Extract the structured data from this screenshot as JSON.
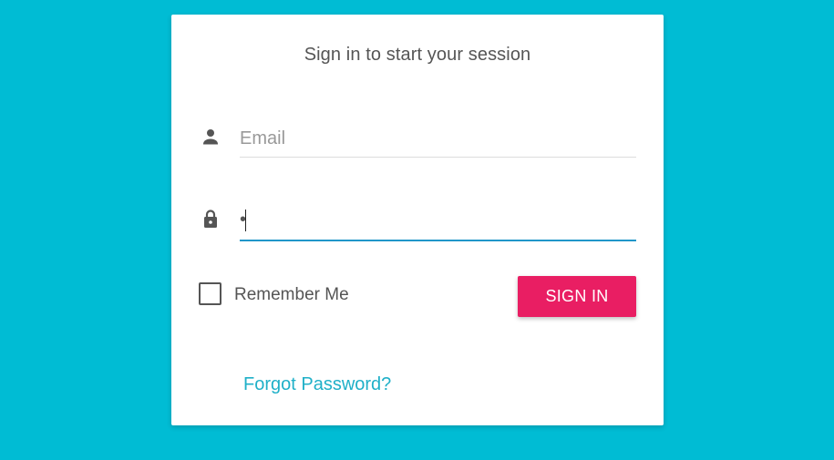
{
  "login": {
    "title": "Sign in to start your session",
    "email": {
      "placeholder": "Email",
      "value": ""
    },
    "password": {
      "value": "•"
    },
    "remember_label": "Remember Me",
    "remember_checked": false,
    "submit_label": "SIGN IN",
    "forgot_link": "Forgot Password?"
  },
  "icons": {
    "email": "person-icon",
    "password": "lock-icon"
  },
  "colors": {
    "background": "#00bcd4",
    "primary_button": "#e91e63",
    "focus_underline": "#2196c9",
    "link": "#1fb0c8"
  }
}
